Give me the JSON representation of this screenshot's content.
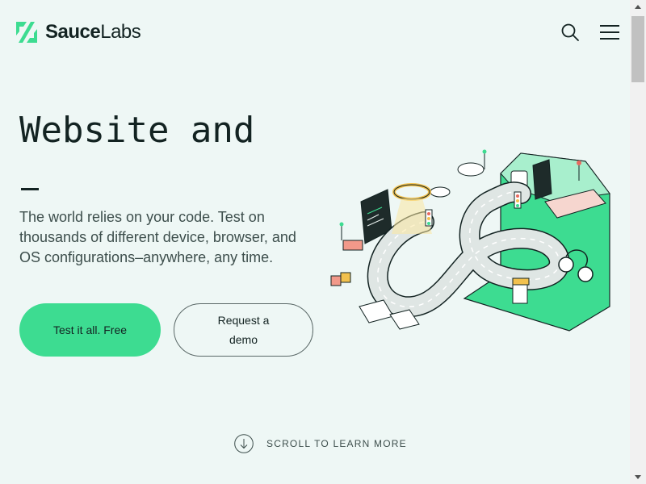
{
  "header": {
    "logo_bold": "Sauce",
    "logo_light": "Labs",
    "search_icon": "search-icon",
    "menu_icon": "hamburger-menu-icon"
  },
  "hero": {
    "title": "Website and",
    "description": "The world relies on your code. Test on thousands of different device, browser, and OS configurations–anywhere, any time.",
    "primary_button": "Test it all. Free",
    "secondary_button": "Request a demo"
  },
  "scroll_prompt": {
    "label": "SCROLL TO LEARN MORE",
    "icon": "arrow-down-circle-icon"
  },
  "colors": {
    "background": "#eef7f5",
    "brand_green": "#3ddc91",
    "text_dark": "#132322",
    "text_muted": "#3d4e4c"
  }
}
